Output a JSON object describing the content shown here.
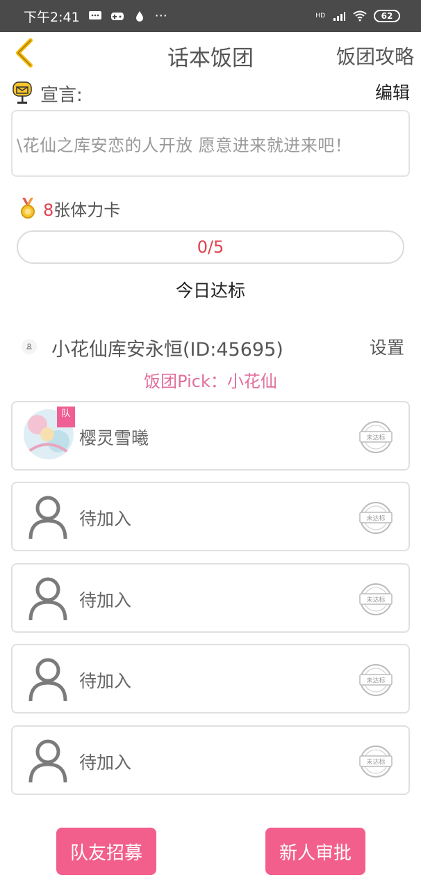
{
  "status_bar": {
    "time": "下午2:41",
    "dots": "···",
    "signal_label": "HD",
    "battery": "62"
  },
  "header": {
    "title": "话本饭团",
    "guide_link": "饭团攻略"
  },
  "declaration": {
    "label": "宣言:",
    "edit_label": "编辑",
    "text": "\\花仙之库安恋的人开放 愿意进来就进来吧！"
  },
  "stamina": {
    "count": "8",
    "suffix": "张体力卡"
  },
  "progress": {
    "text": "0/5",
    "fraction": 0
  },
  "daily_label": "今日达标",
  "leader": {
    "name": "小花仙库安永恒(ID:45695)",
    "settings_label": "设置",
    "pick": "饭团Pick：小花仙"
  },
  "members": [
    {
      "name": "樱灵雪曦",
      "status": "未达标",
      "is_leader": true,
      "flag": "队"
    },
    {
      "name": "待加入",
      "status": "未达标",
      "is_leader": false
    },
    {
      "name": "待加入",
      "status": "未达标",
      "is_leader": false
    },
    {
      "name": "待加入",
      "status": "未达标",
      "is_leader": false
    },
    {
      "name": "待加入",
      "status": "未达标",
      "is_leader": false
    }
  ],
  "buttons": {
    "recruit": "队友招募",
    "approve": "新人审批"
  },
  "colors": {
    "accent": "#f25f8c",
    "pick_pink": "#e26f9c",
    "count_red": "#e0424f",
    "back_yellow": "#f5b800",
    "status_bar": "#4a4a4a"
  },
  "icons": [
    "back-arrow-icon",
    "mailbox-icon",
    "medal-icon",
    "user-avatar-icon",
    "not-met-stamp-icon"
  ]
}
